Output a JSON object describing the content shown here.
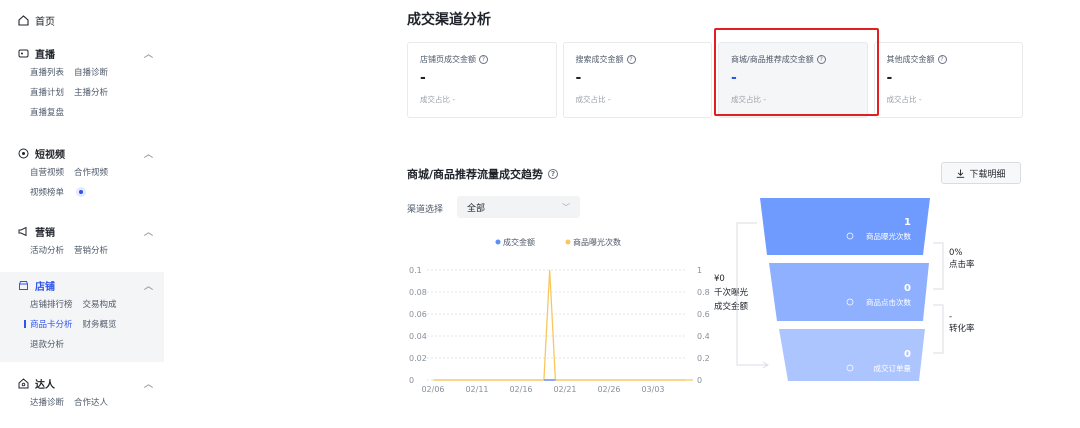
{
  "sidebar": {
    "home": "首页",
    "groups": [
      {
        "title": "直播",
        "icon": "live-icon",
        "rows": [
          [
            "直播列表",
            "自播诊断"
          ],
          [
            "直播计划",
            "主播分析"
          ],
          [
            "直播复盘"
          ]
        ]
      },
      {
        "title": "短视频",
        "icon": "video-icon",
        "rows": [
          [
            "自营视频",
            "合作视频"
          ],
          [
            "视频榜单"
          ]
        ]
      },
      {
        "title": "营销",
        "icon": "megaphone-icon",
        "rows": [
          [
            "活动分析",
            "营销分析"
          ]
        ]
      },
      {
        "title": "店铺",
        "icon": "store-icon",
        "rows": [
          [
            "店铺排行榜",
            "交易构成"
          ],
          [
            "商品卡分析",
            "财务概览"
          ],
          [
            "退款分析"
          ]
        ]
      },
      {
        "title": "达人",
        "icon": "talent-icon",
        "rows": [
          [
            "达播诊断",
            "合作达人"
          ]
        ]
      }
    ]
  },
  "main": {
    "title": "成交渠道分析",
    "cards": [
      {
        "label": "店铺页成交金额",
        "value": "-",
        "ratio": "成交占比 -"
      },
      {
        "label": "搜索成交金额",
        "value": "-",
        "ratio": "成交占比 -"
      },
      {
        "label": "商城/商品推荐成交金额",
        "value": "-",
        "ratio": "成交占比 -"
      },
      {
        "label": "其他成交金额",
        "value": "-",
        "ratio": "成交占比 -"
      }
    ],
    "trend_title": "商城/商品推荐流量成交趋势",
    "download": "下载明细",
    "channel_label": "渠道选择",
    "channel_value": "全部"
  },
  "chart_data": {
    "type": "line",
    "x": [
      "02/06",
      "02/11",
      "02/16",
      "02/21",
      "02/26",
      "03/03"
    ],
    "series": [
      {
        "name": "成交金额",
        "color": "#5b8ff9",
        "points": [
          [
            0,
            0
          ],
          [
            27,
            0
          ]
        ]
      },
      {
        "name": "商品曝光次数",
        "color": "#f6c85f",
        "points": [
          [
            0,
            0
          ],
          [
            11.4,
            0
          ],
          [
            12.0,
            1
          ],
          [
            12.6,
            0
          ],
          [
            27,
            0
          ]
        ]
      }
    ],
    "x_domain": [
      0,
      27
    ],
    "y_left": {
      "ticks": [
        "0",
        "0.02",
        "0.04",
        "0.06",
        "0.08",
        "0.1"
      ],
      "range": [
        0,
        0.1
      ]
    },
    "y_right": {
      "ticks": [
        "0",
        "0.2",
        "0.4",
        "0.6",
        "0.8",
        "1"
      ],
      "range": [
        0,
        1
      ]
    },
    "legend_position": "top-center"
  },
  "funnel": {
    "left_text": [
      "¥0",
      "千次曝光",
      "成交金额"
    ],
    "stages": [
      {
        "value": "1",
        "label": "商品曝光次数"
      },
      {
        "value": "0",
        "label": "商品点击次数"
      },
      {
        "value": "0",
        "label": "成交订单量"
      }
    ],
    "rates": [
      {
        "value": "0%",
        "label": "点击率"
      },
      {
        "value": "-",
        "label": "转化率"
      }
    ],
    "colors": [
      "#6f9bff",
      "#8eb0ff",
      "#adc5ff"
    ]
  }
}
